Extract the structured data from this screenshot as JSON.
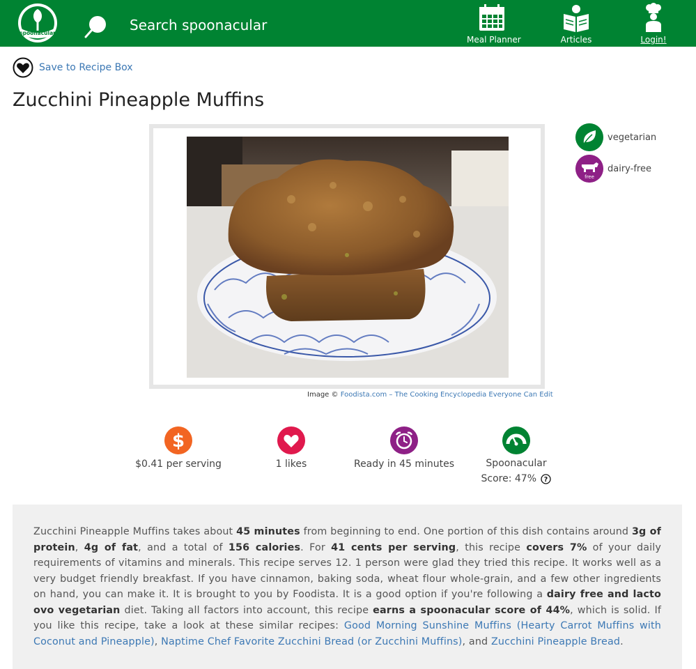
{
  "header": {
    "brand": "spoonacular",
    "search_placeholder": "Search spoonacular",
    "nav": {
      "meal_planner": "Meal Planner",
      "articles": "Articles",
      "login": "Login!"
    }
  },
  "recipe": {
    "save_label": "Save to Recipe Box",
    "title": "Zucchini Pineapple Muffins",
    "image_credit_prefix": "Image ©",
    "image_credit_link": "Foodista.com – The Cooking Encyclopedia Everyone Can Edit",
    "diets": [
      "vegetarian",
      "dairy-free"
    ],
    "dairy_free_badge_text": "free"
  },
  "stats": {
    "price": "$0.41 per serving",
    "likes": "1 likes",
    "time": "Ready in 45 minutes",
    "score_line1": "Spoonacular",
    "score_line2": "Score: 47%"
  },
  "summary": {
    "p1": "Zucchini Pineapple Muffins takes about ",
    "b1": "45 minutes",
    "p2": " from beginning to end. One portion of this dish contains around ",
    "b2": "3g of protein",
    "p3": ", ",
    "b3": "4g of fat",
    "p4": ", and a total of ",
    "b4": "156 calories",
    "p5": ". For ",
    "b5": "41 cents per serving",
    "p6": ", this recipe ",
    "b6": "covers 7%",
    "p7": " of your daily requirements of vitamins and minerals. This recipe serves 12. 1 person were glad they tried this recipe. It works well as a very budget friendly breakfast. If you have cinnamon, baking soda, wheat flour whole-grain, and a few other ingredients on hand, you can make it. It is brought to you by Foodista. It is a good option if you're following a ",
    "b7": "dairy free and lacto ovo vegetarian",
    "p8": " diet. Taking all factors into account, this recipe ",
    "b8": "earns a spoonacular score of 44%",
    "p9": ", which is solid. If you like this recipe, take a look at these similar recipes: ",
    "link1": "Good Morning Sunshine Muffins (Hearty Carrot Muffins with Coconut and Pineapple)",
    "p10": ", ",
    "link2": "Naptime Chef Favorite Zucchini Bread (or Zucchini Muffins)",
    "p11": ", and ",
    "link3": "Zucchini Pineapple Bread",
    "p12": "."
  },
  "colors": {
    "brand_green": "#008332",
    "link_blue": "#3c78b4",
    "price_orange": "#f26522",
    "likes_red": "#e0194d",
    "time_purple": "#8e2086",
    "score_green": "#008332"
  },
  "icons": [
    "spoonacular-logo",
    "search-icon",
    "calendar-icon",
    "book-icon",
    "chef-icon",
    "heart-icon",
    "leaf-icon",
    "cow-icon",
    "dollar-icon",
    "alarm-clock-icon",
    "gauge-icon",
    "help-icon"
  ]
}
